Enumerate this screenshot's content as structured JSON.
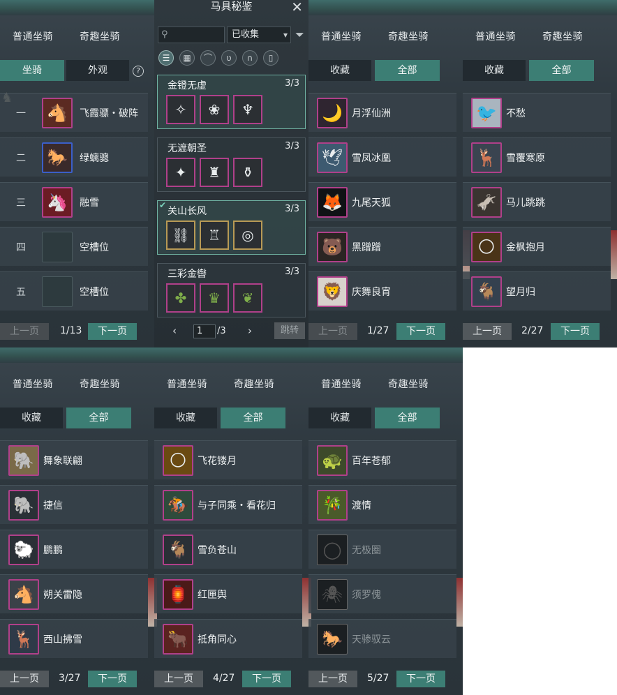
{
  "common": {
    "tab_normal": "普通坐骑",
    "tab_fun": "奇趣坐骑",
    "btn_favorites": "收藏",
    "btn_all": "全部",
    "prev": "上一页",
    "next": "下一页"
  },
  "panel1": {
    "seg_mount": "坐骑",
    "seg_appearance": "外观",
    "help": "?",
    "rows": [
      {
        "num": "一",
        "name": "飞霞骠・破阵",
        "icon": "🐴"
      },
      {
        "num": "二",
        "name": "绿螭骢",
        "icon": "🐎"
      },
      {
        "num": "三",
        "name": "融雪",
        "icon": "🦄"
      },
      {
        "num": "四",
        "name": "空槽位",
        "icon": ""
      },
      {
        "num": "五",
        "name": "空槽位",
        "icon": ""
      }
    ],
    "page": "1/13"
  },
  "center": {
    "title": "马具秘鉴",
    "close": "✕",
    "filter_value": "已收集",
    "sets": [
      {
        "name": "金镫无虚",
        "count": "3/3"
      },
      {
        "name": "无遮朝圣",
        "count": "3/3"
      },
      {
        "name": "关山长风",
        "count": "3/3"
      },
      {
        "name": "三彩金辔",
        "count": "3/3"
      }
    ],
    "page_input": "1",
    "page_total": "/3",
    "jump": "跳转"
  },
  "panel3": {
    "rows": [
      "月浮仙洲",
      "雪凤冰凰",
      "九尾天狐",
      "黑蹭蹭",
      "庆舞良宵"
    ],
    "page": "1/27"
  },
  "panel4": {
    "rows": [
      "不愁",
      "雪覆寒原",
      "马儿跳跳",
      "金枫抱月",
      "望月归"
    ],
    "page": "2/27"
  },
  "panel5": {
    "rows": [
      "舞象联翩",
      "捷信",
      "鹏鹏",
      "朔关雷隐",
      "西山拂雪"
    ],
    "page": "3/27"
  },
  "panel6": {
    "rows": [
      "飞花镂月",
      "与子同乘・看花归",
      "雪负苍山",
      "红匣舆",
      "抵角同心"
    ],
    "page": "4/27"
  },
  "panel7": {
    "rows": [
      "百年苍郁",
      "渡情",
      "无极圈",
      "须罗傀",
      "天骖驭云"
    ],
    "page": "5/27"
  }
}
